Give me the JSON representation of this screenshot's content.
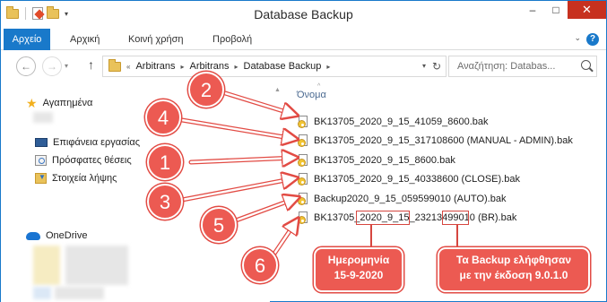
{
  "window": {
    "title": "Database Backup"
  },
  "ribbon": {
    "tabs": [
      "Αρχείο",
      "Αρχική",
      "Κοινή χρήση",
      "Προβολή"
    ]
  },
  "address": {
    "crumbs": [
      "Arbitrans",
      "Arbitrans",
      "Database Backup"
    ]
  },
  "search": {
    "placeholder": "Αναζήτηση: Databas..."
  },
  "nav": {
    "favorites": "Αγαπημένα",
    "items": [
      "Επιφάνεια εργασίας",
      "Πρόσφατες θέσεις",
      "Στοιχεία λήψης"
    ],
    "onedrive": "OneDrive"
  },
  "list": {
    "column": "Όνομα",
    "files": [
      "BK13705_2020_9_15_41059_8600.bak",
      "BK13705_2020_9_15_317108600 (MANUAL - ADMIN).bak",
      "BK13705_2020_9_15_8600.bak",
      "BK13705_2020_9_15_40338600 (CLOSE).bak",
      "Backup2020_9_15_059599010 (AUTO).bak"
    ],
    "last_file": {
      "prefix": "BK13705_",
      "date": "2020_9_15",
      "mid": "_2321349",
      "version": "9010",
      "suffix": " (BR).bak"
    }
  },
  "annotations": {
    "badges": [
      "2",
      "4",
      "1",
      "3",
      "5",
      "6"
    ],
    "date_note": {
      "line1": "Ημερομηνία",
      "line2": "15-9-2020"
    },
    "version_note": {
      "line1": "Τα Backup ελήφθησαν",
      "line2": "με την έκδοση 9.0.1.0"
    },
    "color": "#ec5a52"
  },
  "colors": {
    "accent": "#1979ca",
    "close": "#c7311f"
  }
}
